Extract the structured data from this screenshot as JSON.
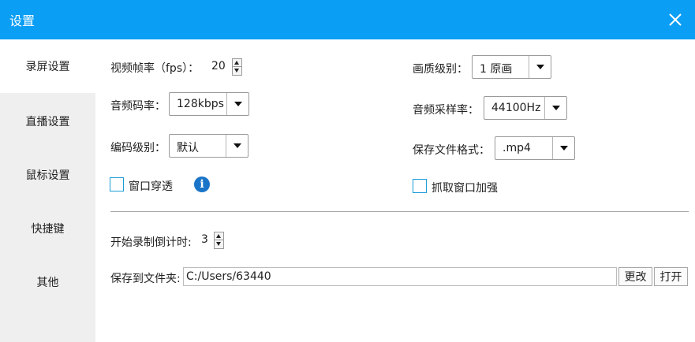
{
  "window": {
    "title": "设置"
  },
  "sidebar": {
    "items": [
      {
        "label": "录屏设置"
      },
      {
        "label": "直播设置"
      },
      {
        "label": "鼠标设置"
      },
      {
        "label": "快捷键"
      },
      {
        "label": "其他"
      }
    ],
    "active": "录屏设置"
  },
  "recording": {
    "fps": {
      "label": "视频帧率（fps）：",
      "value": "20"
    },
    "quality": {
      "label": "画质级别：",
      "value": "1 原画"
    },
    "audio_bitrate": {
      "label": "音频码率：",
      "value": "128kbps"
    },
    "sample_rate": {
      "label": "音频采样率：",
      "value": "44100Hz"
    },
    "encoder_level": {
      "label": "编码级别：",
      "value": "默认"
    },
    "file_format": {
      "label": "保存文件格式：",
      "value": ".mp4"
    },
    "window_passthrough": {
      "label": "窗口穿透",
      "checked": false
    },
    "capture_enhance": {
      "label": "抓取窗口加强",
      "checked": false
    },
    "info_icon": "i",
    "countdown": {
      "label": "开始录制倒计时:",
      "value": "3"
    },
    "save_folder": {
      "label": "保存到文件夹:",
      "value": "C:/Users/63440"
    },
    "change_button": "更改",
    "open_button": "打开"
  },
  "colors": {
    "titlebar": "#0a9ef5",
    "sidebar": "#efefef",
    "checkbox_border": "#1a9bd7",
    "info_icon": "#1a75c8"
  }
}
